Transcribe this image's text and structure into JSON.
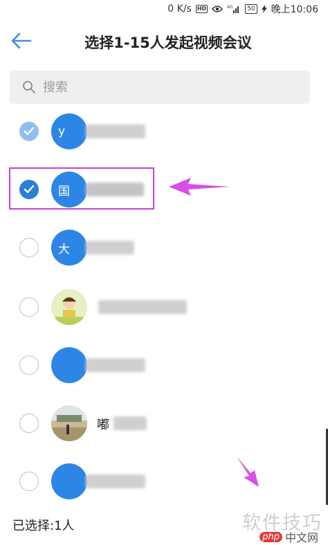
{
  "status_bar": {
    "speed": "0 K/s",
    "hd": "HD",
    "network": "4G",
    "battery": "50",
    "time": "晚上10:06"
  },
  "header": {
    "title": "选择1-15人发起视频会议"
  },
  "search": {
    "placeholder": "搜索"
  },
  "contacts": [
    {
      "avatar_text": "y",
      "checked": true
    },
    {
      "avatar_text": "国",
      "checked": true
    },
    {
      "avatar_text": "大",
      "checked": false
    },
    {
      "avatar_text": "",
      "checked": false
    },
    {
      "avatar_text": "",
      "checked": false
    },
    {
      "avatar_text": "",
      "name": "嘟",
      "checked": false
    },
    {
      "avatar_text": "",
      "checked": false
    }
  ],
  "footer": {
    "selected_label": "已选择:1人"
  },
  "watermark": {
    "text": "软件技巧",
    "logo_php": "php",
    "logo_site": "中文网"
  },
  "colors": {
    "accent": "#2b7fdc",
    "highlight": "#c73ed8",
    "arrow": "#d94ee8"
  }
}
